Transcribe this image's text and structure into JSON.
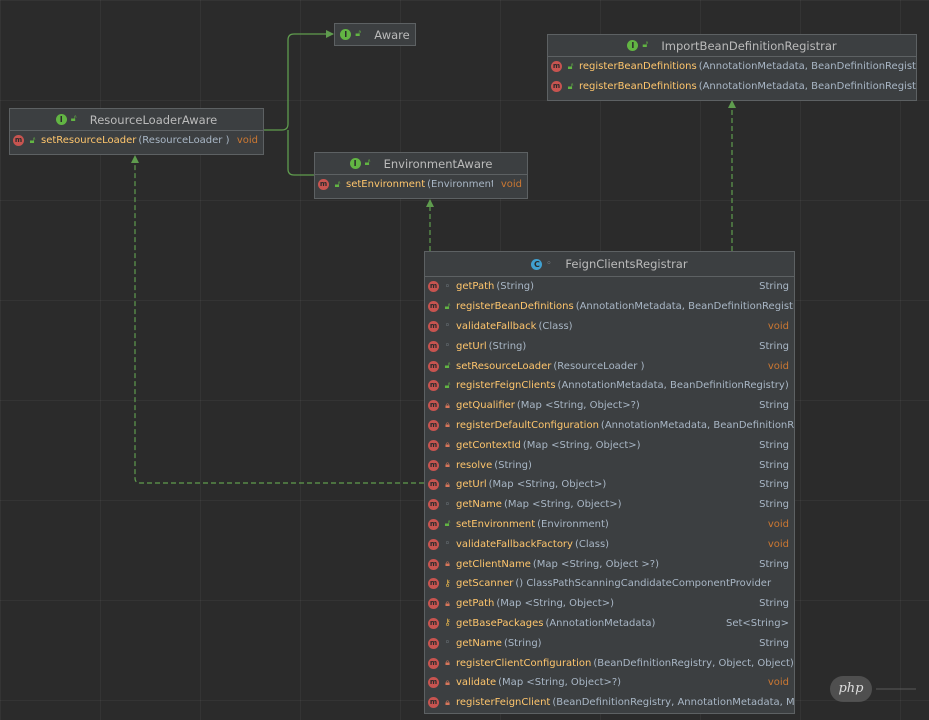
{
  "diagram": {
    "nodes": {
      "aware": {
        "kind": "I",
        "name": "Aware",
        "members": []
      },
      "resource_loader_aware": {
        "kind": "I",
        "name": "ResourceLoaderAware",
        "members": [
          {
            "access": "public",
            "name": "setResourceLoader",
            "params": "(ResourceLoader )",
            "ret": "void"
          }
        ]
      },
      "environment_aware": {
        "kind": "I",
        "name": "EnvironmentAware",
        "members": [
          {
            "access": "public",
            "name": "setEnvironment",
            "params": "(Environment )",
            "ret": "void"
          }
        ]
      },
      "import_bean_definition_registrar": {
        "kind": "I",
        "name": "ImportBeanDefinitionRegistrar",
        "members": [
          {
            "access": "public",
            "name": "registerBeanDefinitions",
            "params": "(AnnotationMetadata, BeanDefinitionRegistr",
            "ret": ""
          },
          {
            "access": "public",
            "name": "registerBeanDefinitions",
            "params": "(AnnotationMetadata, BeanDefinitionRegistr",
            "ret": ""
          }
        ]
      },
      "feign_clients_registrar": {
        "kind": "C",
        "name": "FeignClientsRegistrar",
        "members": [
          {
            "access": "package",
            "name": "getPath",
            "params": "(String)",
            "ret": "String"
          },
          {
            "access": "public",
            "name": "registerBeanDefinitions",
            "params": "(AnnotationMetadata, BeanDefinitionRegistr",
            "ret": ""
          },
          {
            "access": "package",
            "name": "validateFallback",
            "params": "(Class)",
            "ret": "void"
          },
          {
            "access": "package",
            "name": "getUrl",
            "params": "(String)",
            "ret": "String"
          },
          {
            "access": "public",
            "name": "setResourceLoader",
            "params": "(ResourceLoader )",
            "ret": "void"
          },
          {
            "access": "public",
            "name": "registerFeignClients",
            "params": "(AnnotationMetadata, BeanDefinitionRegistry)",
            "ret": ""
          },
          {
            "access": "private",
            "name": "getQualifier",
            "params": "(Map <String, Object>?)",
            "ret": "String"
          },
          {
            "access": "private",
            "name": "registerDefaultConfiguration",
            "params": "(AnnotationMetadata, BeanDefinitionRe",
            "ret": ""
          },
          {
            "access": "private",
            "name": "getContextId",
            "params": "(Map <String, Object>)",
            "ret": "String"
          },
          {
            "access": "private",
            "name": "resolve",
            "params": "(String)",
            "ret": "String"
          },
          {
            "access": "private",
            "name": "getUrl",
            "params": "(Map <String, Object>)",
            "ret": "String"
          },
          {
            "access": "package",
            "name": "getName",
            "params": "(Map <String, Object>)",
            "ret": "String"
          },
          {
            "access": "public",
            "name": "setEnvironment",
            "params": "(Environment)",
            "ret": "void"
          },
          {
            "access": "package",
            "name": "validateFallbackFactory",
            "params": "(Class)",
            "ret": "void"
          },
          {
            "access": "private",
            "name": "getClientName",
            "params": "(Map <String, Object >?)",
            "ret": "String"
          },
          {
            "access": "protected",
            "name": "getScanner",
            "params": "()       ClassPathScanningCandidateComponentProvider",
            "ret": ""
          },
          {
            "access": "private",
            "name": "getPath",
            "params": "(Map <String, Object>)",
            "ret": "String"
          },
          {
            "access": "protected",
            "name": "getBasePackages",
            "params": " (AnnotationMetadata)",
            "ret": "Set<String>"
          },
          {
            "access": "package",
            "name": "getName",
            "params": "(String)",
            "ret": "String"
          },
          {
            "access": "private",
            "name": "registerClientConfiguration",
            "params": "(BeanDefinitionRegistry, Object, Object)",
            "ret": ""
          },
          {
            "access": "private",
            "name": "validate",
            "params": "(Map <String, Object>?)",
            "ret": "void"
          },
          {
            "access": "private",
            "name": "registerFeignClient",
            "params": "(BeanDefinitionRegistry, AnnotationMetadata, M",
            "ret": ""
          }
        ]
      }
    },
    "edges": [
      {
        "from": "resource_loader_aware",
        "to": "aware",
        "style": "solid"
      },
      {
        "from": "environment_aware",
        "to": "aware",
        "style": "solid"
      },
      {
        "from": "feign_clients_registrar",
        "to": "resource_loader_aware",
        "style": "dashed"
      },
      {
        "from": "feign_clients_registrar",
        "to": "environment_aware",
        "style": "dashed"
      },
      {
        "from": "feign_clients_registrar",
        "to": "import_bean_definition_registrar",
        "style": "dashed"
      }
    ],
    "colors": {
      "background": "#2b2b2b",
      "node_fill": "#3c3f41",
      "node_border": "#5d6163",
      "edge": "#5f9c4e",
      "method_badge": "#c75450",
      "interface_badge": "#62b543",
      "class_badge": "#40a0d0",
      "method_name": "#ffc66d",
      "void_keyword": "#cc7832"
    }
  },
  "watermark": {
    "text": "php"
  }
}
